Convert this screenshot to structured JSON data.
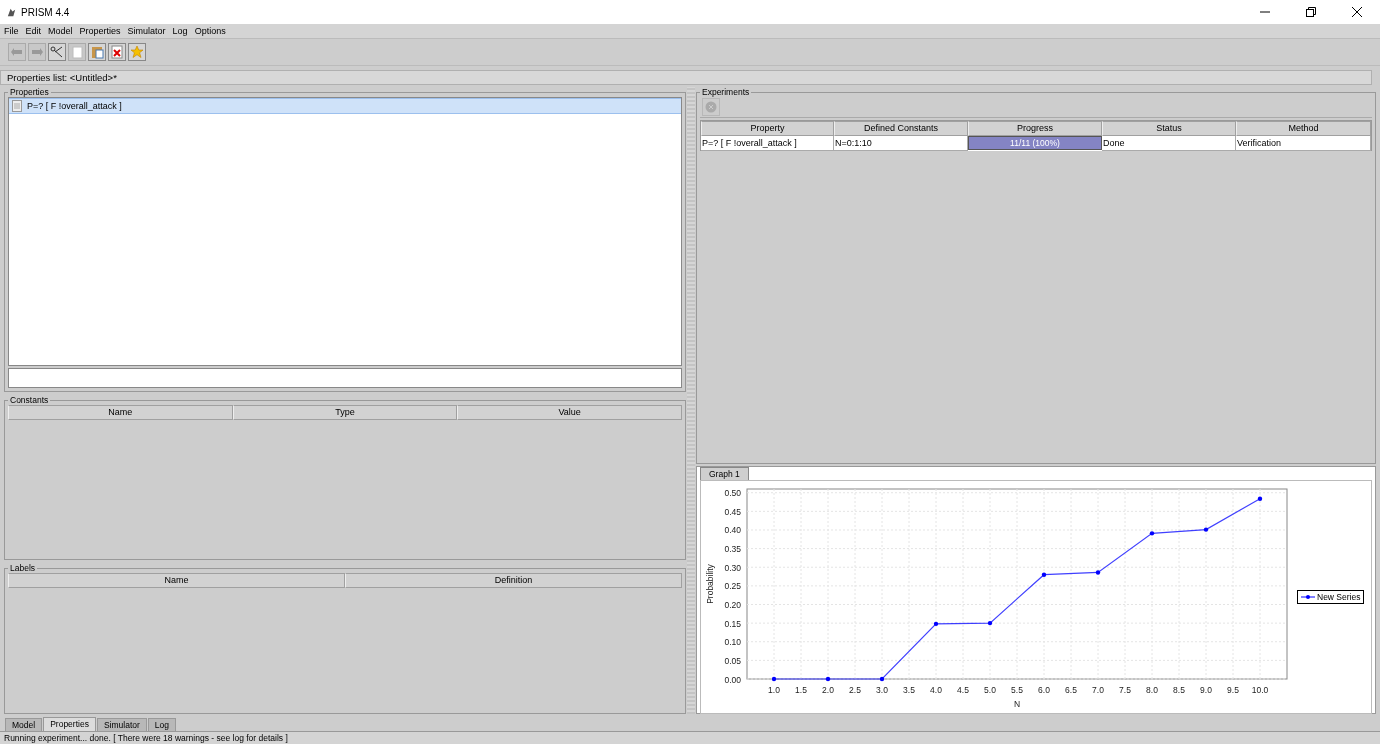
{
  "window": {
    "title": "PRISM 4.4"
  },
  "menu": [
    {
      "label": "File"
    },
    {
      "label": "Edit"
    },
    {
      "label": "Model"
    },
    {
      "label": "Properties"
    },
    {
      "label": "Simulator"
    },
    {
      "label": "Log"
    },
    {
      "label": "Options"
    }
  ],
  "toolbar": [
    {
      "kind": "undo",
      "disabled": true
    },
    {
      "kind": "redo",
      "disabled": true
    },
    {
      "kind": "cut",
      "disabled": false
    },
    {
      "kind": "copy",
      "disabled": true
    },
    {
      "kind": "paste",
      "disabled": false
    },
    {
      "kind": "delete",
      "disabled": false
    },
    {
      "kind": "star",
      "disabled": false
    }
  ],
  "properties_list_title": "Properties list: <Untitled>*",
  "properties": {
    "title": "Properties",
    "items": [
      {
        "text": "P=? [ F !overall_attack ]",
        "selected": true
      }
    ]
  },
  "constants": {
    "title": "Constants",
    "columns": [
      "Name",
      "Type",
      "Value"
    ]
  },
  "labels": {
    "title": "Labels",
    "columns": [
      "Name",
      "Definition"
    ]
  },
  "experiments": {
    "title": "Experiments",
    "columns": [
      "Property",
      "Defined Constants",
      "Progress",
      "Status",
      "Method"
    ],
    "rows": [
      {
        "property": "P=? [ F !overall_attack ]",
        "constants": "N=0:1:10",
        "progress_text": "11/11 (100%)",
        "level": 1.0,
        "status": "Done",
        "method": "Verification"
      }
    ]
  },
  "graph": {
    "tab": "Graph 1",
    "chart_data": {
      "type": "line",
      "grid": true,
      "xlabel": "N",
      "ylabel": "Probability",
      "x": [
        1,
        2,
        3,
        4,
        5,
        6,
        7,
        8,
        9,
        10
      ],
      "series": [
        {
          "name": "New Series",
          "color": "#0000ff",
          "values": [
            0,
            0,
            0,
            0.148,
            0.15,
            0.28,
            0.286,
            0.391,
            0.401,
            0.484
          ]
        }
      ],
      "xlim": [
        0.5,
        10.5
      ],
      "ylim": [
        0,
        0.51
      ],
      "xticks": [
        {
          "value": 1,
          "label": "1.0"
        },
        {
          "value": 1.5,
          "label": "1.5"
        },
        {
          "value": 2,
          "label": "2.0"
        },
        {
          "value": 2.5,
          "label": "2.5"
        },
        {
          "value": 3,
          "label": "3.0"
        },
        {
          "value": 3.5,
          "label": "3.5"
        },
        {
          "value": 4,
          "label": "4.0"
        },
        {
          "value": 4.5,
          "label": "4.5"
        },
        {
          "value": 5,
          "label": "5.0"
        },
        {
          "value": 5.5,
          "label": "5.5"
        },
        {
          "value": 6,
          "label": "6.0"
        },
        {
          "value": 6.5,
          "label": "6.5"
        },
        {
          "value": 7,
          "label": "7.0"
        },
        {
          "value": 7.5,
          "label": "7.5"
        },
        {
          "value": 8,
          "label": "8.0"
        },
        {
          "value": 8.5,
          "label": "8.5"
        },
        {
          "value": 9,
          "label": "9.0"
        },
        {
          "value": 9.5,
          "label": "9.5"
        },
        {
          "value": 10,
          "label": "10.0"
        }
      ],
      "yticks": [
        {
          "value": 0,
          "label": "0.00"
        },
        {
          "value": 0.05,
          "label": "0.05"
        },
        {
          "value": 0.1,
          "label": "0.10"
        },
        {
          "value": 0.15,
          "label": "0.15"
        },
        {
          "value": 0.2,
          "label": "0.20"
        },
        {
          "value": 0.25,
          "label": "0.25"
        },
        {
          "value": 0.3,
          "label": "0.30"
        },
        {
          "value": 0.35,
          "label": "0.35"
        },
        {
          "value": 0.4,
          "label": "0.40"
        },
        {
          "value": 0.45,
          "label": "0.45"
        },
        {
          "value": 0.5,
          "label": "0.50"
        }
      ]
    }
  },
  "bottom_tabs": [
    {
      "label": "Model",
      "selected": false
    },
    {
      "label": "Properties",
      "selected": true
    },
    {
      "label": "Simulator",
      "selected": false
    },
    {
      "label": "Log",
      "selected": false
    }
  ],
  "status_bar": "Running experiment... done.  [ There were 18 warnings - see log for details ]"
}
